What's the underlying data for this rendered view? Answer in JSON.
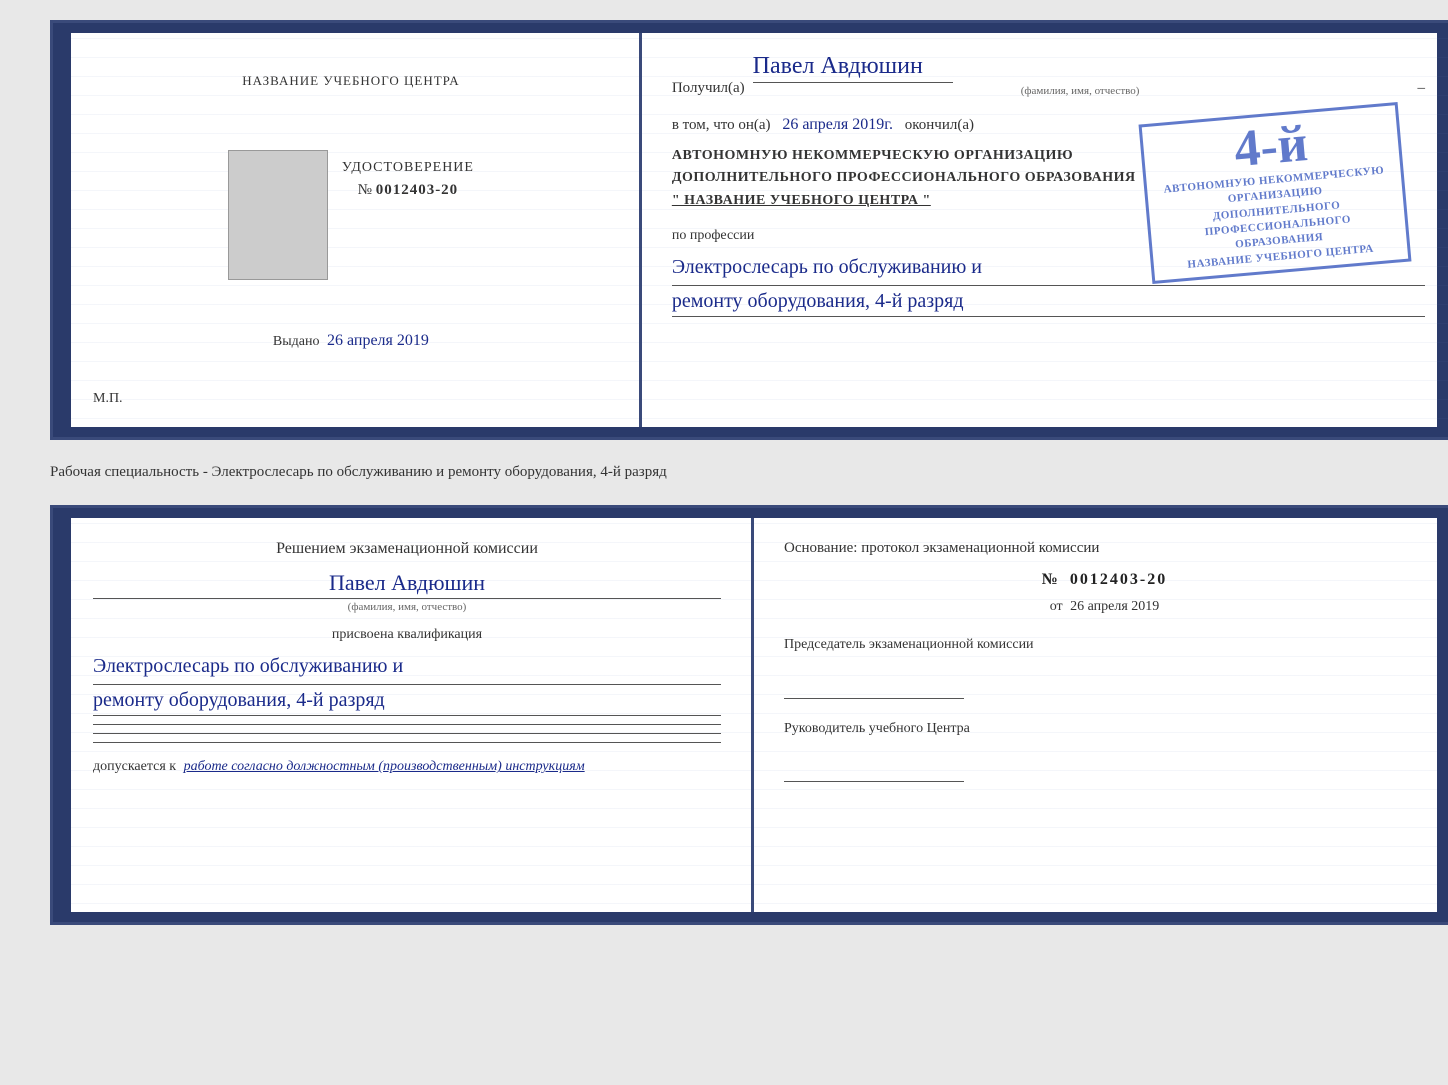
{
  "top_cert": {
    "left": {
      "header": "НАЗВАНИЕ УЧЕБНОГО ЦЕНТРА",
      "cert_label": "УДОСТОВЕРЕНИЕ",
      "cert_number_prefix": "№",
      "cert_number": "0012403-20",
      "issued_label": "Выдано",
      "issued_date": "26 апреля 2019",
      "mp_label": "М.П."
    },
    "right": {
      "recipient_label": "Получил(а)",
      "recipient_name": "Павел Авдюшин",
      "fio_small": "(фамилия, имя, отчество)",
      "in_that_label": "в том, что он(а)",
      "date_handwritten": "26 апреля 2019г.",
      "finished_label": "окончил(а)",
      "org_line1": "АВТОНОМНУЮ НЕКОММЕРЧЕСКУЮ ОРГАНИЗАЦИЮ",
      "org_line2": "ДОПОЛНИТЕЛЬНОГО ПРОФЕССИОНАЛЬНОГО ОБРАЗОВАНИЯ",
      "org_name": "\" НАЗВАНИЕ УЧЕБНОГО ЦЕНТРА \"",
      "profession_label": "по профессии",
      "profession_line1": "Электрослесарь по обслуживанию и",
      "profession_line2": "ремонту оборудования, 4-й разряд"
    },
    "stamp": {
      "grade": "4-й",
      "line1": "АВТОНОМНУЮ НЕКОММЕРЧЕСКУЮ ОРГАНИЗАЦИЮ",
      "line2": "ДОПОЛНИТЕЛЬНОГО ПРОФЕССИОНАЛЬНОГО ОБРАЗОВАНИЯ",
      "line3": "НАЗВАНИЕ УЧЕБНОГО ЦЕНТРА"
    }
  },
  "middle": {
    "text": "Рабочая специальность - Электрослесарь по обслуживанию и ремонту оборудования, 4-й разряд"
  },
  "bottom_cert": {
    "left": {
      "commission_header": "Решением экзаменационной комиссии",
      "person_name": "Павел Авдюшин",
      "fio_small": "(фамилия, имя, отчество)",
      "qualification_label": "присвоена квалификация",
      "profession_line1": "Электрослесарь по обслуживанию и",
      "profession_line2": "ремонту оборудования, 4-й разряд",
      "allowed_label": "допускается к",
      "allowed_italic": "работе согласно должностным (производственным) инструкциям"
    },
    "right": {
      "basis_label": "Основание: протокол экзаменационной комиссии",
      "doc_number_prefix": "№",
      "doc_number": "0012403-20",
      "doc_date_prefix": "от",
      "doc_date": "26 апреля 2019",
      "chairman_label": "Председатель экзаменационной комиссии",
      "director_label": "Руководитель учебного Центра"
    }
  }
}
